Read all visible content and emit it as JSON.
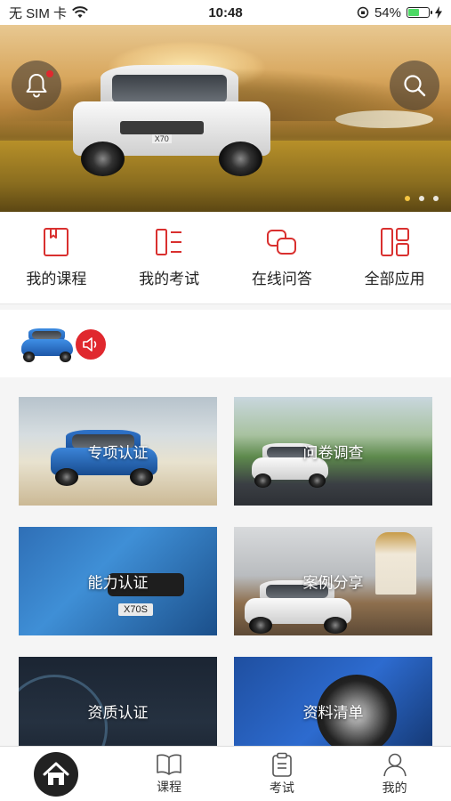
{
  "status_bar": {
    "carrier": "无 SIM 卡",
    "time": "10:48",
    "battery": "54%",
    "battery_level": 0.54
  },
  "banner": {
    "car_badge": "X70",
    "pages": 3,
    "active_page": 1
  },
  "quick_nav": [
    {
      "label": "我的课程",
      "icon": "book-icon"
    },
    {
      "label": "我的考试",
      "icon": "exam-list-icon"
    },
    {
      "label": "在线问答",
      "icon": "chat-icon"
    },
    {
      "label": "全部应用",
      "icon": "apps-grid-icon"
    }
  ],
  "modules": [
    {
      "title": "专项认证"
    },
    {
      "title": "问卷调查"
    },
    {
      "title": "能力认证",
      "badge": "X70S"
    },
    {
      "title": "案例分享"
    },
    {
      "title": "资质认证"
    },
    {
      "title": "资料清单"
    }
  ],
  "tabbar": [
    {
      "label": "",
      "icon": "home-icon"
    },
    {
      "label": "课程",
      "icon": "open-book-icon"
    },
    {
      "label": "考试",
      "icon": "clipboard-icon"
    },
    {
      "label": "我的",
      "icon": "person-icon"
    }
  ],
  "colors": {
    "accent": "#e0282e",
    "battery": "#4cd964",
    "text": "#222222"
  }
}
